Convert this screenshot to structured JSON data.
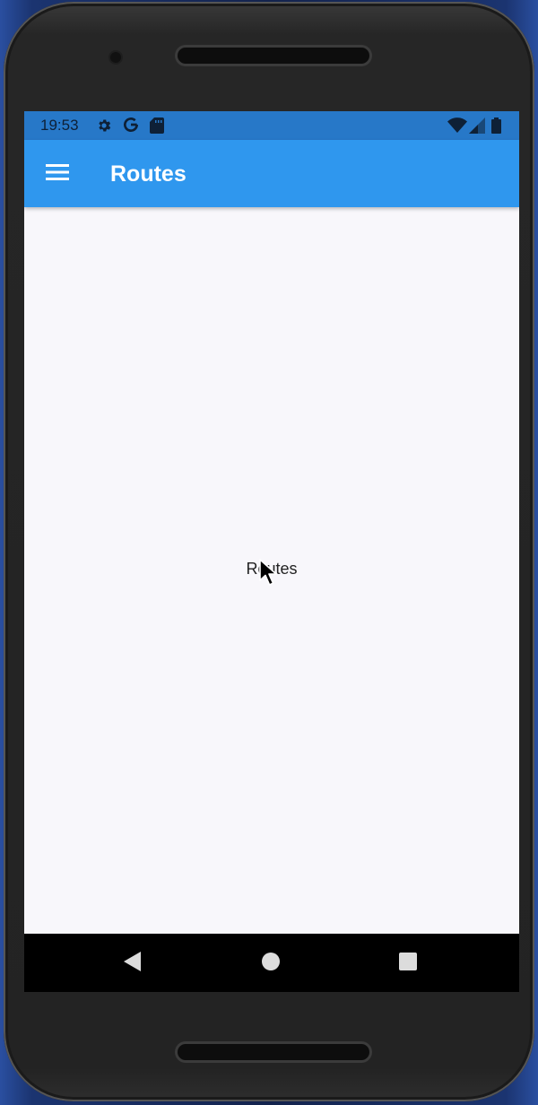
{
  "status_bar": {
    "time": "19:53",
    "left_icons": [
      "gear-icon",
      "google-icon",
      "sd-card-icon"
    ],
    "right_icons": [
      "wifi-icon",
      "signal-icon",
      "battery-icon"
    ]
  },
  "app_bar": {
    "menu_icon": "hamburger-menu-icon",
    "title": "Routes"
  },
  "body": {
    "center_text": "Routes"
  },
  "nav_bar": {
    "buttons": [
      "back-icon",
      "home-icon",
      "recents-icon"
    ]
  },
  "colors": {
    "status_bar": "#2778c8",
    "app_bar": "#2f97ee",
    "screen_bg": "#f8f7fb",
    "nav_bar": "#000000"
  }
}
